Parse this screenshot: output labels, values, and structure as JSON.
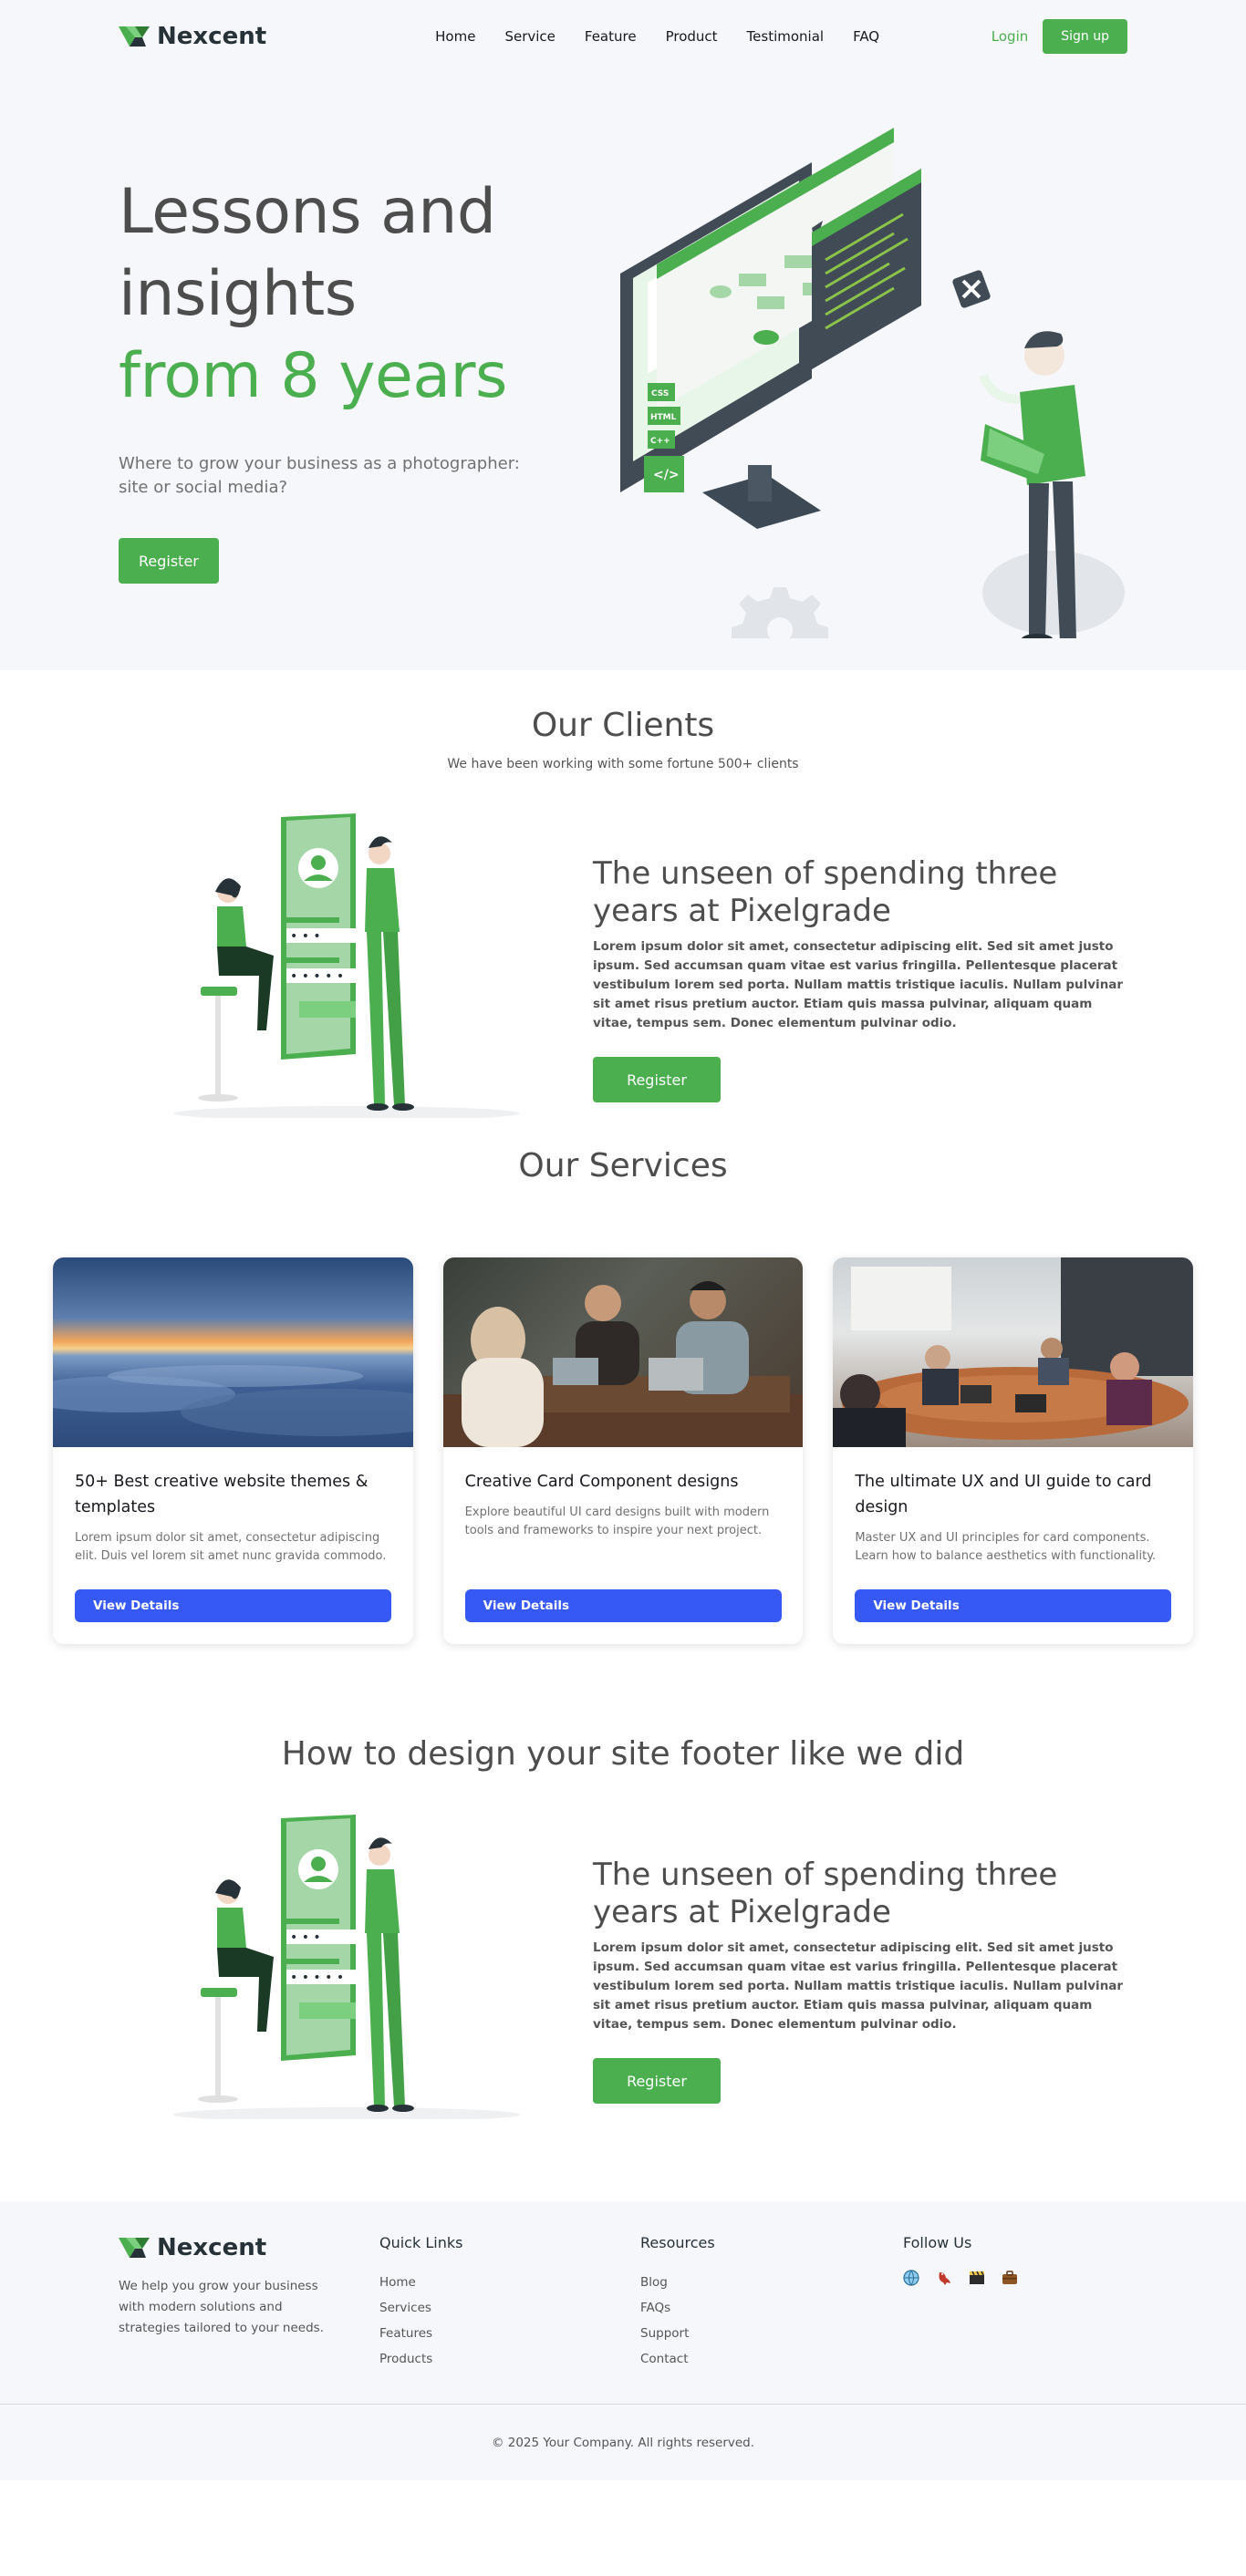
{
  "brand": {
    "name": "Nexcent",
    "accent": "#4caf4f",
    "button_blue": "#3659f5"
  },
  "nav": {
    "items": [
      "Home",
      "Service",
      "Feature",
      "Product",
      "Testimonial",
      "FAQ"
    ],
    "login": "Login",
    "signup": "Sign up"
  },
  "hero": {
    "line1": "Lessons and",
    "line2": "insights",
    "line3": "from 8 years",
    "subtitle": "Where to grow your business as a photographer: site or social media?",
    "button": "Register"
  },
  "clients": {
    "title": "Our Clients",
    "subtitle": "We have been working with some fortune 500+ clients"
  },
  "feature1": {
    "heading": "The unseen of spending three years at Pixelgrade",
    "body": "Lorem ipsum dolor sit amet, consectetur adipiscing elit. Sed sit amet justo ipsum. Sed accumsan quam vitae est varius fringilla. Pellentesque placerat vestibulum lorem sed porta. Nullam mattis tristique iaculis. Nullam pulvinar sit amet risus pretium auctor. Etiam quis massa pulvinar, aliquam quam vitae, tempus sem. Donec elementum pulvinar odio.",
    "button": "Register"
  },
  "services": {
    "title": "Our Services",
    "cards": [
      {
        "title": "50+ Best creative website themes & templates",
        "desc": "Lorem ipsum dolor sit amet, consectetur adipiscing elit. Duis vel lorem sit amet nunc gravida commodo.",
        "button": "View Details"
      },
      {
        "title": "Creative Card Component designs",
        "desc": "Explore beautiful UI card designs built with modern tools and frameworks to inspire your next project.",
        "button": "View Details"
      },
      {
        "title": "The ultimate UX and UI guide to card design",
        "desc": "Master UX and UI principles for card components. Learn how to balance aesthetics with functionality.",
        "button": "View Details"
      }
    ]
  },
  "footer_section": {
    "title": "How to design your site footer like we did"
  },
  "feature2": {
    "heading": "The unseen of spending three years at Pixelgrade",
    "body": "Lorem ipsum dolor sit amet, consectetur adipiscing elit. Sed sit amet justo ipsum. Sed accumsan quam vitae est varius fringilla. Pellentesque placerat vestibulum lorem sed porta. Nullam mattis tristique iaculis. Nullam pulvinar sit amet risus pretium auctor. Etiam quis massa pulvinar, aliquam quam vitae, tempus sem. Donec elementum pulvinar odio.",
    "button": "Register"
  },
  "footer": {
    "brand": "Nexcent",
    "about": "We help you grow your business with modern solutions and strategies tailored to your needs.",
    "quick_links": {
      "title": "Quick Links",
      "items": [
        "Home",
        "Services",
        "Features",
        "Products"
      ]
    },
    "resources": {
      "title": "Resources",
      "items": [
        "Blog",
        "FAQs",
        "Support",
        "Contact"
      ]
    },
    "follow": {
      "title": "Follow Us",
      "icons": [
        "globe-icon",
        "bird-icon",
        "clapper-icon",
        "briefcase-icon"
      ]
    },
    "copyright": "© 2025 Your Company. All rights reserved."
  }
}
